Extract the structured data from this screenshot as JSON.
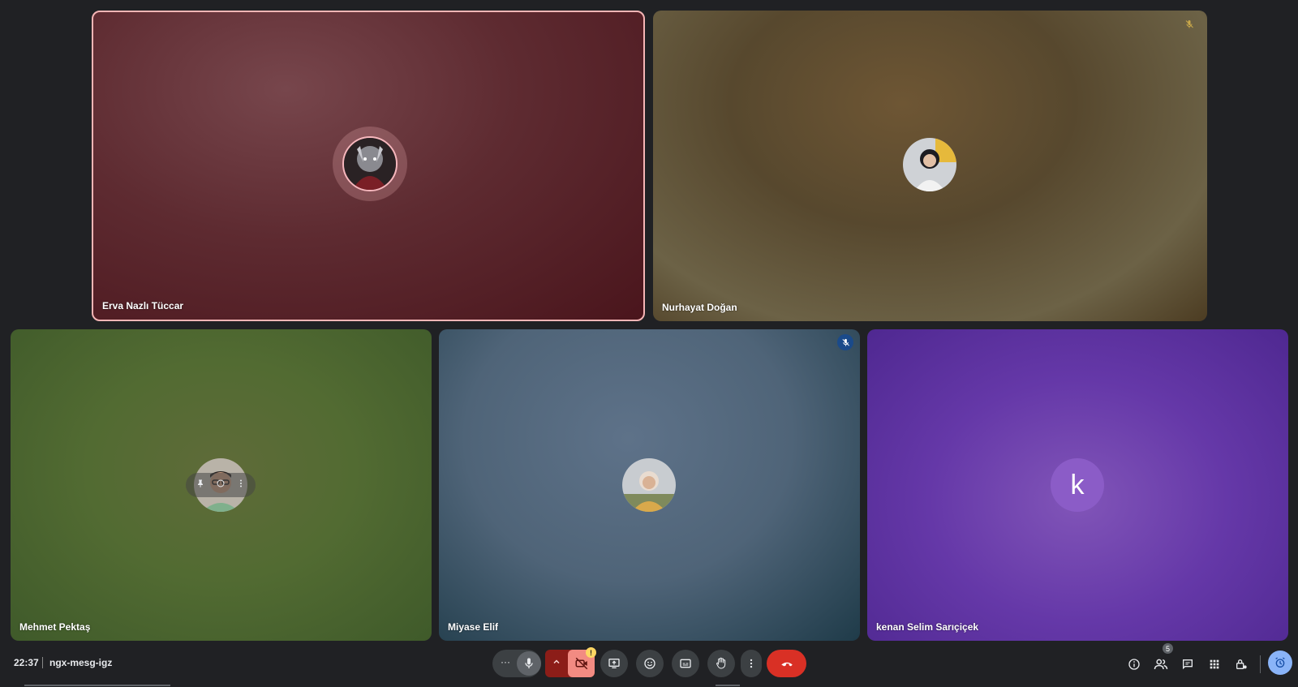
{
  "participants": [
    {
      "name": "Erva Nazlı Tüccar",
      "speaking": true
    },
    {
      "name": "Nurhayat Doğan",
      "muted": true
    },
    {
      "name": "Mehmet Pektaş"
    },
    {
      "name": "Miyase Elif",
      "muted": true
    },
    {
      "name": "kenan Selim Sarıçiçek",
      "initial": "k"
    }
  ],
  "footer": {
    "time": "22:37",
    "meeting_code": "ngx-mesg-igz",
    "people_count": "5",
    "camera_warning": "!"
  },
  "controls": {
    "more_options_label": "···"
  },
  "colors": {
    "end_call": "#d93025",
    "camera_off": "#f28b82",
    "speaking_border": "#f5b5b5",
    "activity_accent": "#8ab4f8"
  }
}
